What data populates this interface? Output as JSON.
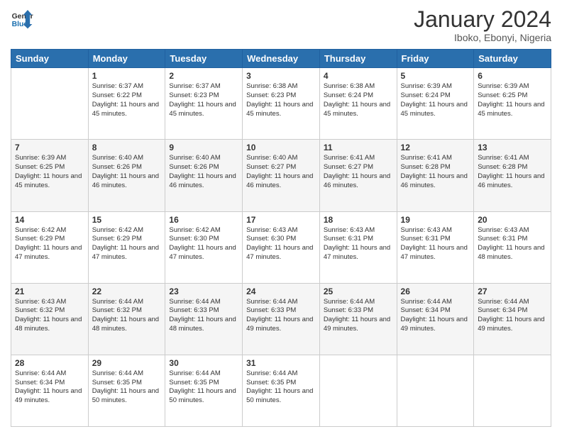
{
  "header": {
    "logo_line1": "General",
    "logo_line2": "Blue",
    "title": "January 2024",
    "subtitle": "Iboko, Ebonyi, Nigeria"
  },
  "days_of_week": [
    "Sunday",
    "Monday",
    "Tuesday",
    "Wednesday",
    "Thursday",
    "Friday",
    "Saturday"
  ],
  "weeks": [
    [
      {
        "day": "",
        "sunrise": "",
        "sunset": "",
        "daylight": ""
      },
      {
        "day": "1",
        "sunrise": "Sunrise: 6:37 AM",
        "sunset": "Sunset: 6:22 PM",
        "daylight": "Daylight: 11 hours and 45 minutes."
      },
      {
        "day": "2",
        "sunrise": "Sunrise: 6:37 AM",
        "sunset": "Sunset: 6:23 PM",
        "daylight": "Daylight: 11 hours and 45 minutes."
      },
      {
        "day": "3",
        "sunrise": "Sunrise: 6:38 AM",
        "sunset": "Sunset: 6:23 PM",
        "daylight": "Daylight: 11 hours and 45 minutes."
      },
      {
        "day": "4",
        "sunrise": "Sunrise: 6:38 AM",
        "sunset": "Sunset: 6:24 PM",
        "daylight": "Daylight: 11 hours and 45 minutes."
      },
      {
        "day": "5",
        "sunrise": "Sunrise: 6:39 AM",
        "sunset": "Sunset: 6:24 PM",
        "daylight": "Daylight: 11 hours and 45 minutes."
      },
      {
        "day": "6",
        "sunrise": "Sunrise: 6:39 AM",
        "sunset": "Sunset: 6:25 PM",
        "daylight": "Daylight: 11 hours and 45 minutes."
      }
    ],
    [
      {
        "day": "7",
        "sunrise": "Sunrise: 6:39 AM",
        "sunset": "Sunset: 6:25 PM",
        "daylight": "Daylight: 11 hours and 45 minutes."
      },
      {
        "day": "8",
        "sunrise": "Sunrise: 6:40 AM",
        "sunset": "Sunset: 6:26 PM",
        "daylight": "Daylight: 11 hours and 46 minutes."
      },
      {
        "day": "9",
        "sunrise": "Sunrise: 6:40 AM",
        "sunset": "Sunset: 6:26 PM",
        "daylight": "Daylight: 11 hours and 46 minutes."
      },
      {
        "day": "10",
        "sunrise": "Sunrise: 6:40 AM",
        "sunset": "Sunset: 6:27 PM",
        "daylight": "Daylight: 11 hours and 46 minutes."
      },
      {
        "day": "11",
        "sunrise": "Sunrise: 6:41 AM",
        "sunset": "Sunset: 6:27 PM",
        "daylight": "Daylight: 11 hours and 46 minutes."
      },
      {
        "day": "12",
        "sunrise": "Sunrise: 6:41 AM",
        "sunset": "Sunset: 6:28 PM",
        "daylight": "Daylight: 11 hours and 46 minutes."
      },
      {
        "day": "13",
        "sunrise": "Sunrise: 6:41 AM",
        "sunset": "Sunset: 6:28 PM",
        "daylight": "Daylight: 11 hours and 46 minutes."
      }
    ],
    [
      {
        "day": "14",
        "sunrise": "Sunrise: 6:42 AM",
        "sunset": "Sunset: 6:29 PM",
        "daylight": "Daylight: 11 hours and 47 minutes."
      },
      {
        "day": "15",
        "sunrise": "Sunrise: 6:42 AM",
        "sunset": "Sunset: 6:29 PM",
        "daylight": "Daylight: 11 hours and 47 minutes."
      },
      {
        "day": "16",
        "sunrise": "Sunrise: 6:42 AM",
        "sunset": "Sunset: 6:30 PM",
        "daylight": "Daylight: 11 hours and 47 minutes."
      },
      {
        "day": "17",
        "sunrise": "Sunrise: 6:43 AM",
        "sunset": "Sunset: 6:30 PM",
        "daylight": "Daylight: 11 hours and 47 minutes."
      },
      {
        "day": "18",
        "sunrise": "Sunrise: 6:43 AM",
        "sunset": "Sunset: 6:31 PM",
        "daylight": "Daylight: 11 hours and 47 minutes."
      },
      {
        "day": "19",
        "sunrise": "Sunrise: 6:43 AM",
        "sunset": "Sunset: 6:31 PM",
        "daylight": "Daylight: 11 hours and 47 minutes."
      },
      {
        "day": "20",
        "sunrise": "Sunrise: 6:43 AM",
        "sunset": "Sunset: 6:31 PM",
        "daylight": "Daylight: 11 hours and 48 minutes."
      }
    ],
    [
      {
        "day": "21",
        "sunrise": "Sunrise: 6:43 AM",
        "sunset": "Sunset: 6:32 PM",
        "daylight": "Daylight: 11 hours and 48 minutes."
      },
      {
        "day": "22",
        "sunrise": "Sunrise: 6:44 AM",
        "sunset": "Sunset: 6:32 PM",
        "daylight": "Daylight: 11 hours and 48 minutes."
      },
      {
        "day": "23",
        "sunrise": "Sunrise: 6:44 AM",
        "sunset": "Sunset: 6:33 PM",
        "daylight": "Daylight: 11 hours and 48 minutes."
      },
      {
        "day": "24",
        "sunrise": "Sunrise: 6:44 AM",
        "sunset": "Sunset: 6:33 PM",
        "daylight": "Daylight: 11 hours and 49 minutes."
      },
      {
        "day": "25",
        "sunrise": "Sunrise: 6:44 AM",
        "sunset": "Sunset: 6:33 PM",
        "daylight": "Daylight: 11 hours and 49 minutes."
      },
      {
        "day": "26",
        "sunrise": "Sunrise: 6:44 AM",
        "sunset": "Sunset: 6:34 PM",
        "daylight": "Daylight: 11 hours and 49 minutes."
      },
      {
        "day": "27",
        "sunrise": "Sunrise: 6:44 AM",
        "sunset": "Sunset: 6:34 PM",
        "daylight": "Daylight: 11 hours and 49 minutes."
      }
    ],
    [
      {
        "day": "28",
        "sunrise": "Sunrise: 6:44 AM",
        "sunset": "Sunset: 6:34 PM",
        "daylight": "Daylight: 11 hours and 49 minutes."
      },
      {
        "day": "29",
        "sunrise": "Sunrise: 6:44 AM",
        "sunset": "Sunset: 6:35 PM",
        "daylight": "Daylight: 11 hours and 50 minutes."
      },
      {
        "day": "30",
        "sunrise": "Sunrise: 6:44 AM",
        "sunset": "Sunset: 6:35 PM",
        "daylight": "Daylight: 11 hours and 50 minutes."
      },
      {
        "day": "31",
        "sunrise": "Sunrise: 6:44 AM",
        "sunset": "Sunset: 6:35 PM",
        "daylight": "Daylight: 11 hours and 50 minutes."
      },
      {
        "day": "",
        "sunrise": "",
        "sunset": "",
        "daylight": ""
      },
      {
        "day": "",
        "sunrise": "",
        "sunset": "",
        "daylight": ""
      },
      {
        "day": "",
        "sunrise": "",
        "sunset": "",
        "daylight": ""
      }
    ]
  ]
}
